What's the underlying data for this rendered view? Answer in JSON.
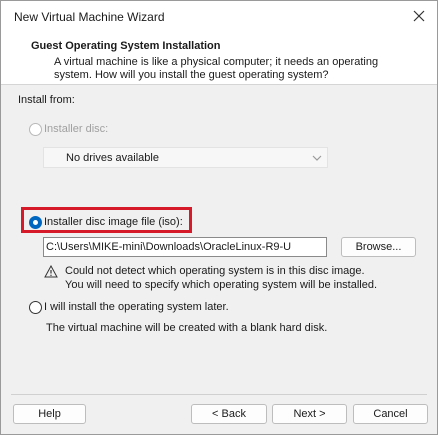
{
  "window": {
    "title": "New Virtual Machine Wizard"
  },
  "header": {
    "title": "Guest Operating System Installation",
    "description": "A virtual machine is like a physical computer; it needs an operating system. How will you install the guest operating system?"
  },
  "install_from": {
    "label": "Install from:",
    "options": [
      {
        "label": "Installer disc:",
        "selected": false,
        "enabled": false
      },
      {
        "label": "Installer disc image file (iso):",
        "selected": true,
        "enabled": true
      },
      {
        "label": "I will install the operating system later.",
        "selected": false,
        "enabled": true
      }
    ],
    "disc_dropdown_value": "No drives available",
    "iso_path": "C:\\Users\\MIKE-mini\\Downloads\\OracleLinux-R9-U",
    "browse_label": "Browse...",
    "warning_line1": "Could not detect which operating system is in this disc image.",
    "warning_line2": "You will need to specify which operating system will be installed.",
    "later_note": "The virtual machine will be created with a blank hard disk."
  },
  "footer": {
    "help_label": "Help",
    "back_label": "< Back",
    "next_label": "Next >",
    "cancel_label": "Cancel"
  },
  "colors": {
    "accent": "#0067c0",
    "highlight_box": "#d61a2a"
  }
}
